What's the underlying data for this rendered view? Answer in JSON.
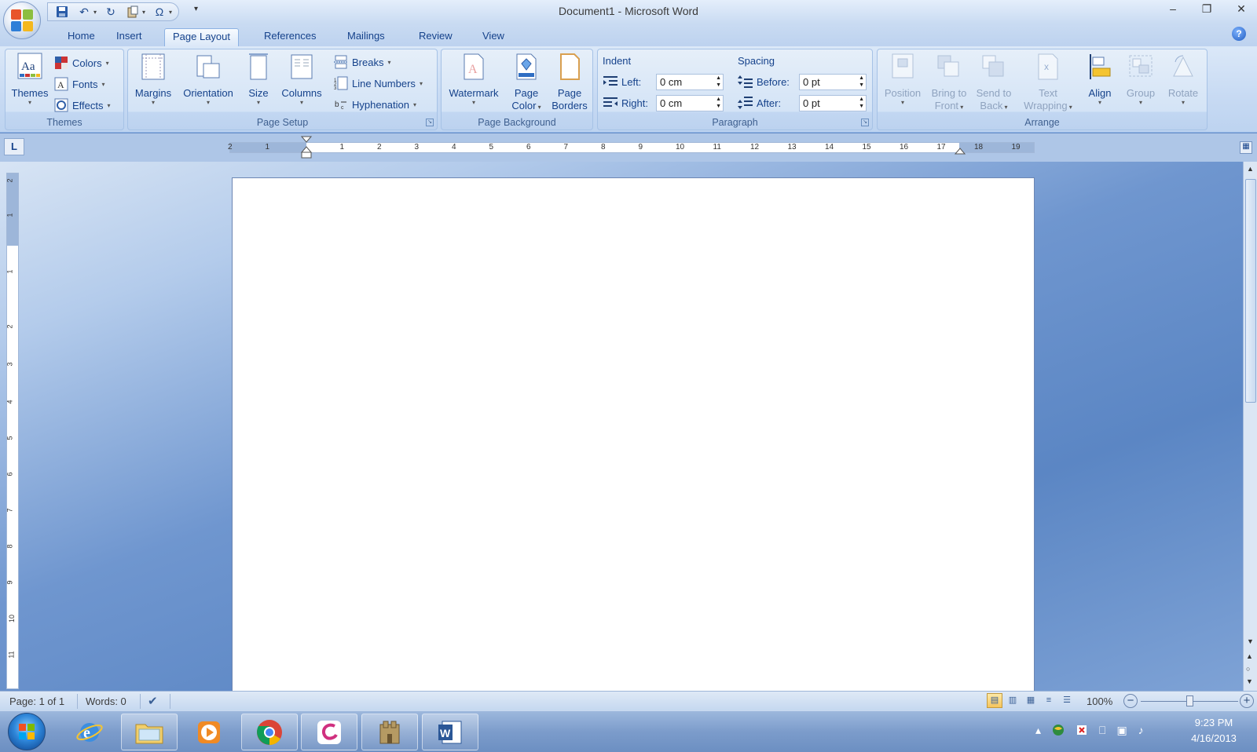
{
  "window": {
    "title": "Document1 - Microsoft Word",
    "minimize": "–",
    "restore": "❐",
    "close": "✕"
  },
  "quick_access": {
    "save_icon": "save-icon",
    "undo_icon": "undo-icon",
    "redo_icon": "redo-icon",
    "paste_icon": "paste-icon",
    "symbol_icon": "Ω",
    "customize_icon": "▾"
  },
  "tabs": [
    {
      "label": "Home",
      "active": false
    },
    {
      "label": "Insert",
      "active": false
    },
    {
      "label": "Page Layout",
      "active": true
    },
    {
      "label": "References",
      "active": false
    },
    {
      "label": "Mailings",
      "active": false
    },
    {
      "label": "Review",
      "active": false
    },
    {
      "label": "View",
      "active": false
    }
  ],
  "help_icon": "?",
  "ribbon": {
    "themes": {
      "label": "Themes",
      "themes_button": "Themes",
      "colors": "Colors",
      "fonts": "Fonts",
      "effects": "Effects"
    },
    "page_setup": {
      "label": "Page Setup",
      "margins": "Margins",
      "orientation": "Orientation",
      "size": "Size",
      "columns": "Columns",
      "breaks": "Breaks",
      "line_numbers": "Line Numbers",
      "hyphenation": "Hyphenation"
    },
    "page_background": {
      "label": "Page Background",
      "watermark": "Watermark",
      "page_color_1": "Page",
      "page_color_2": "Color",
      "page_borders_1": "Page",
      "page_borders_2": "Borders"
    },
    "paragraph": {
      "label": "Paragraph",
      "indent_heading": "Indent",
      "spacing_heading": "Spacing",
      "left_label": "Left:",
      "left_value": "0 cm",
      "right_label": "Right:",
      "right_value": "0 cm",
      "before_label": "Before:",
      "before_value": "0 pt",
      "after_label": "After:",
      "after_value": "0 pt"
    },
    "arrange": {
      "label": "Arrange",
      "position": "Position",
      "bring_front_1": "Bring to",
      "bring_front_2": "Front",
      "send_back_1": "Send to",
      "send_back_2": "Back",
      "text_wrapping_1": "Text",
      "text_wrapping_2": "Wrapping",
      "align": "Align",
      "group": "Group",
      "rotate": "Rotate"
    }
  },
  "ruler": {
    "tab_selector": "L",
    "ticks": [
      "2",
      "1",
      "",
      "1",
      "2",
      "3",
      "4",
      "5",
      "6",
      "7",
      "8",
      "9",
      "10",
      "11",
      "12",
      "13",
      "14",
      "15",
      "16",
      "17",
      "18",
      "19"
    ],
    "vticks": [
      "2",
      "1",
      "1",
      "2",
      "3",
      "4",
      "5",
      "6",
      "7",
      "8",
      "9",
      "10",
      "11"
    ]
  },
  "status": {
    "page": "Page: 1 of 1",
    "words": "Words: 0",
    "zoom": "100%",
    "zoom_fraction": 0.5
  },
  "taskbar": {
    "apps": [
      "internet-explorer-icon",
      "file-explorer-icon",
      "media-player-icon",
      "chrome-icon",
      "creative-app-icon",
      "game-app-icon",
      "word-icon"
    ],
    "time": "9:23 PM",
    "date": "4/16/2013"
  }
}
